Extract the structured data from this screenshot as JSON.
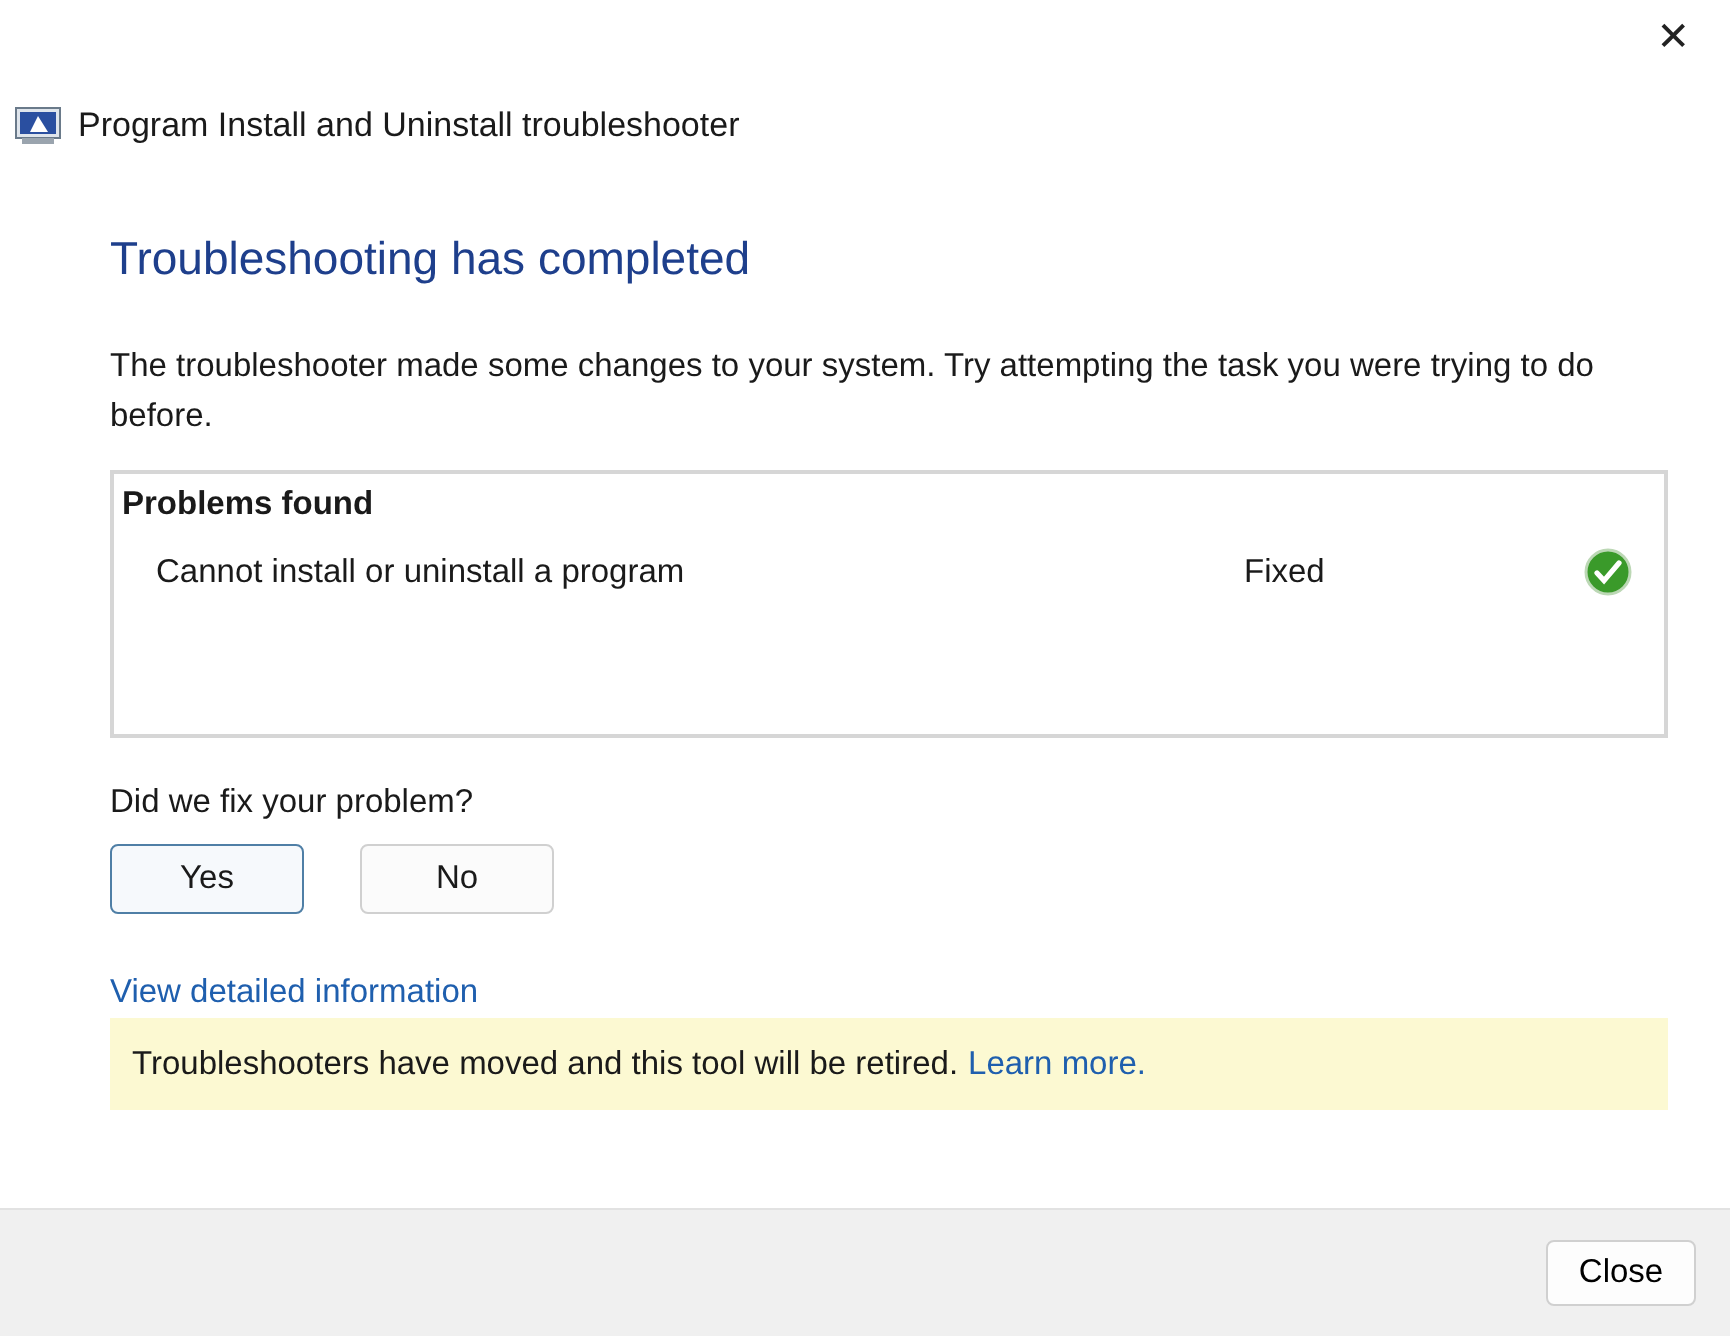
{
  "window": {
    "title": "Program Install and Uninstall troubleshooter",
    "close_glyph": "✕"
  },
  "heading": "Troubleshooting has completed",
  "description": "The troubleshooter made some changes to your system. Try attempting the task you were trying to do before.",
  "problems": {
    "title": "Problems found",
    "items": [
      {
        "name": "Cannot install or uninstall a program",
        "status": "Fixed",
        "kind": "fixed"
      }
    ]
  },
  "feedback": {
    "question": "Did we fix your problem?",
    "buttons": [
      {
        "label": "Yes",
        "focused": true
      },
      {
        "label": "No",
        "focused": false
      }
    ]
  },
  "details_link": "View detailed information",
  "notice": {
    "text": "Troubleshooters have moved and this tool will be retired.",
    "link": "Learn more."
  },
  "footer": {
    "button": "Close"
  }
}
